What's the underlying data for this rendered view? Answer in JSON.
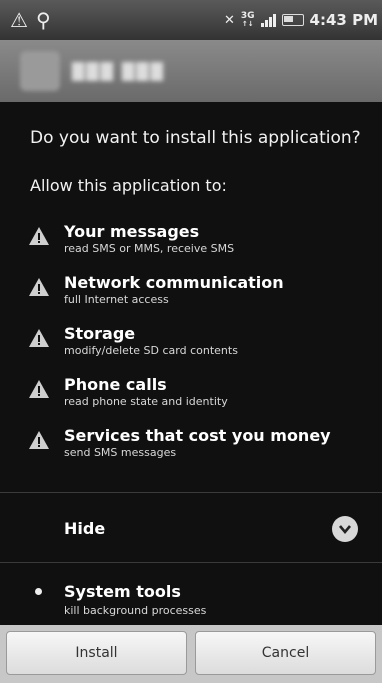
{
  "status_bar": {
    "network": "3G",
    "network_sub": "↑↓",
    "time": "4:43 PM"
  },
  "dialog": {
    "question": "Do you want to install this application?",
    "allow_label": "Allow this application to:",
    "permissions": [
      {
        "title": "Your messages",
        "desc": "read SMS or MMS, receive SMS"
      },
      {
        "title": "Network communication",
        "desc": "full Internet access"
      },
      {
        "title": "Storage",
        "desc": "modify/delete SD card contents"
      },
      {
        "title": "Phone calls",
        "desc": "read phone state and identity"
      },
      {
        "title": "Services that cost you money",
        "desc": "send SMS messages"
      }
    ],
    "hide_label": "Hide",
    "system_tools": {
      "title": "System tools",
      "desc": "kill background processes"
    }
  },
  "buttons": {
    "install": "Install",
    "cancel": "Cancel"
  },
  "colors": {
    "background": "#101010",
    "button_bar": "#c7c7c7",
    "warning_icon": "#cfcfcf"
  }
}
